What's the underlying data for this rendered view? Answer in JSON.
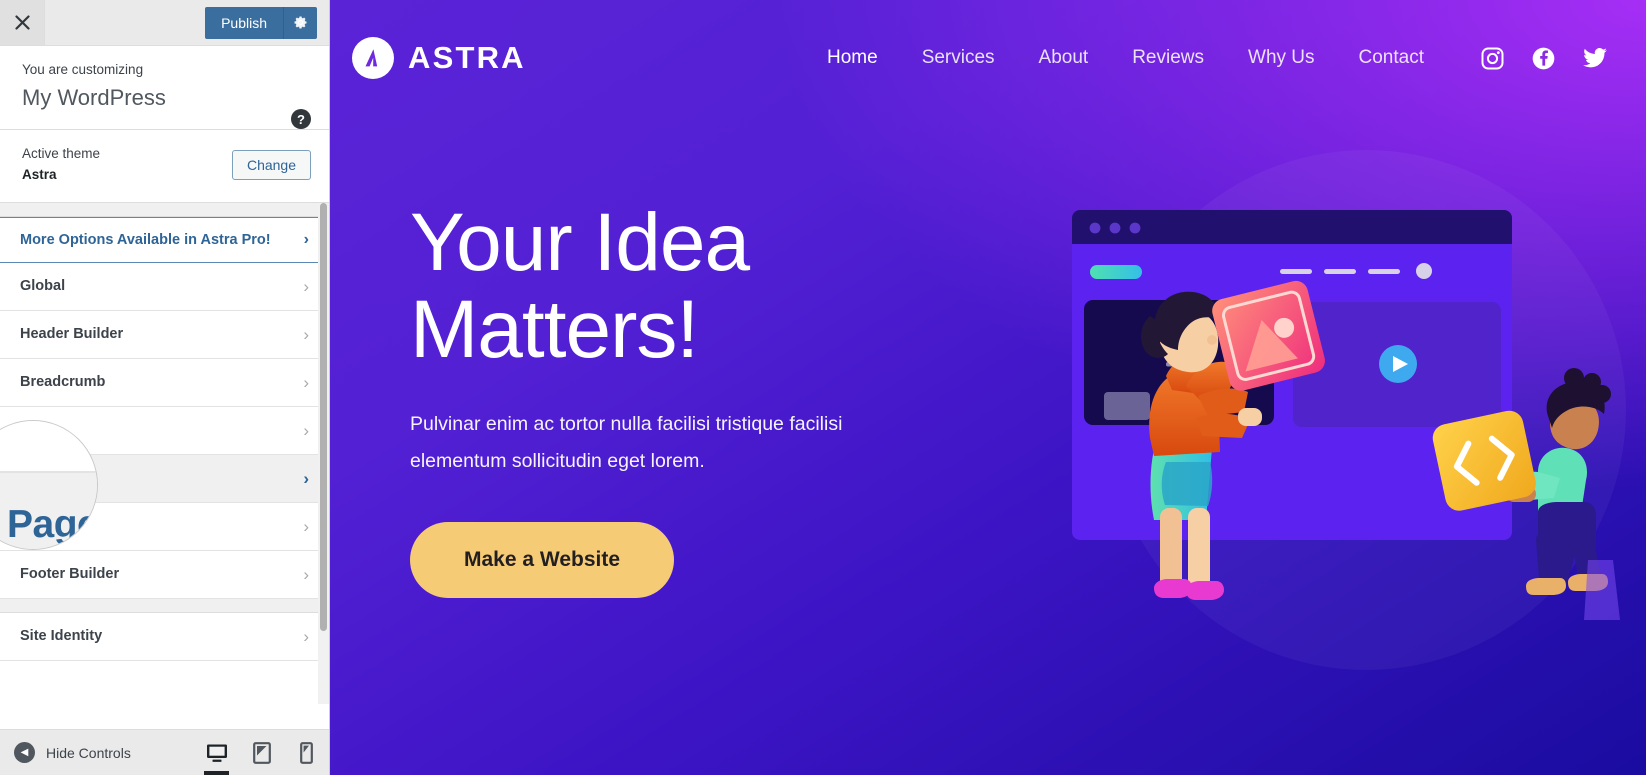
{
  "customizer": {
    "close_label": "×",
    "publish_label": "Publish",
    "gear_label": "Settings",
    "customizing_label": "You are customizing",
    "site_title": "My WordPress",
    "help_label": "?",
    "theme_label": "Active theme",
    "theme_name": "Astra",
    "change_label": "Change",
    "pro_label": "More Options Available in Astra Pro!",
    "panels": [
      {
        "label": "Global",
        "active": false
      },
      {
        "label": "Header Builder",
        "active": false
      },
      {
        "label": "Breadcrumb",
        "active": false
      },
      {
        "label": "",
        "active": false
      },
      {
        "label": "Page",
        "active": true
      },
      {
        "label": "",
        "active": false
      },
      {
        "label": "Footer Builder",
        "active": false
      },
      {
        "label": "Site Identity",
        "active": false
      }
    ],
    "magnifier": {
      "text": "Page"
    },
    "bottom": {
      "hide_controls_label": "Hide Controls",
      "devices": [
        {
          "name": "desktop",
          "active": true
        },
        {
          "name": "tablet",
          "active": false
        },
        {
          "name": "mobile",
          "active": false
        }
      ]
    },
    "colors": {
      "publish_blue": "#3a6e9e",
      "link_blue": "#2f6497"
    }
  },
  "site": {
    "brand": "ASTRA",
    "nav": [
      {
        "label": "Home",
        "active": true
      },
      {
        "label": "Services",
        "active": false
      },
      {
        "label": "About",
        "active": false
      },
      {
        "label": "Reviews",
        "active": false
      },
      {
        "label": "Why Us",
        "active": false
      },
      {
        "label": "Contact",
        "active": false
      }
    ],
    "social": [
      {
        "name": "instagram"
      },
      {
        "name": "facebook"
      },
      {
        "name": "twitter"
      }
    ],
    "hero": {
      "title": "Your Idea\nMatters!",
      "subtitle": "Pulvinar enim ac tortor nulla facilisi tristique facilisi elementum sollicitudin eget lorem.",
      "cta_label": "Make a Website"
    },
    "colors": {
      "gradient_start": "#5b23d6",
      "gradient_end": "#1a0ca0",
      "accent_purple": "#a62ef5",
      "cta_yellow": "#f6cb75"
    }
  }
}
